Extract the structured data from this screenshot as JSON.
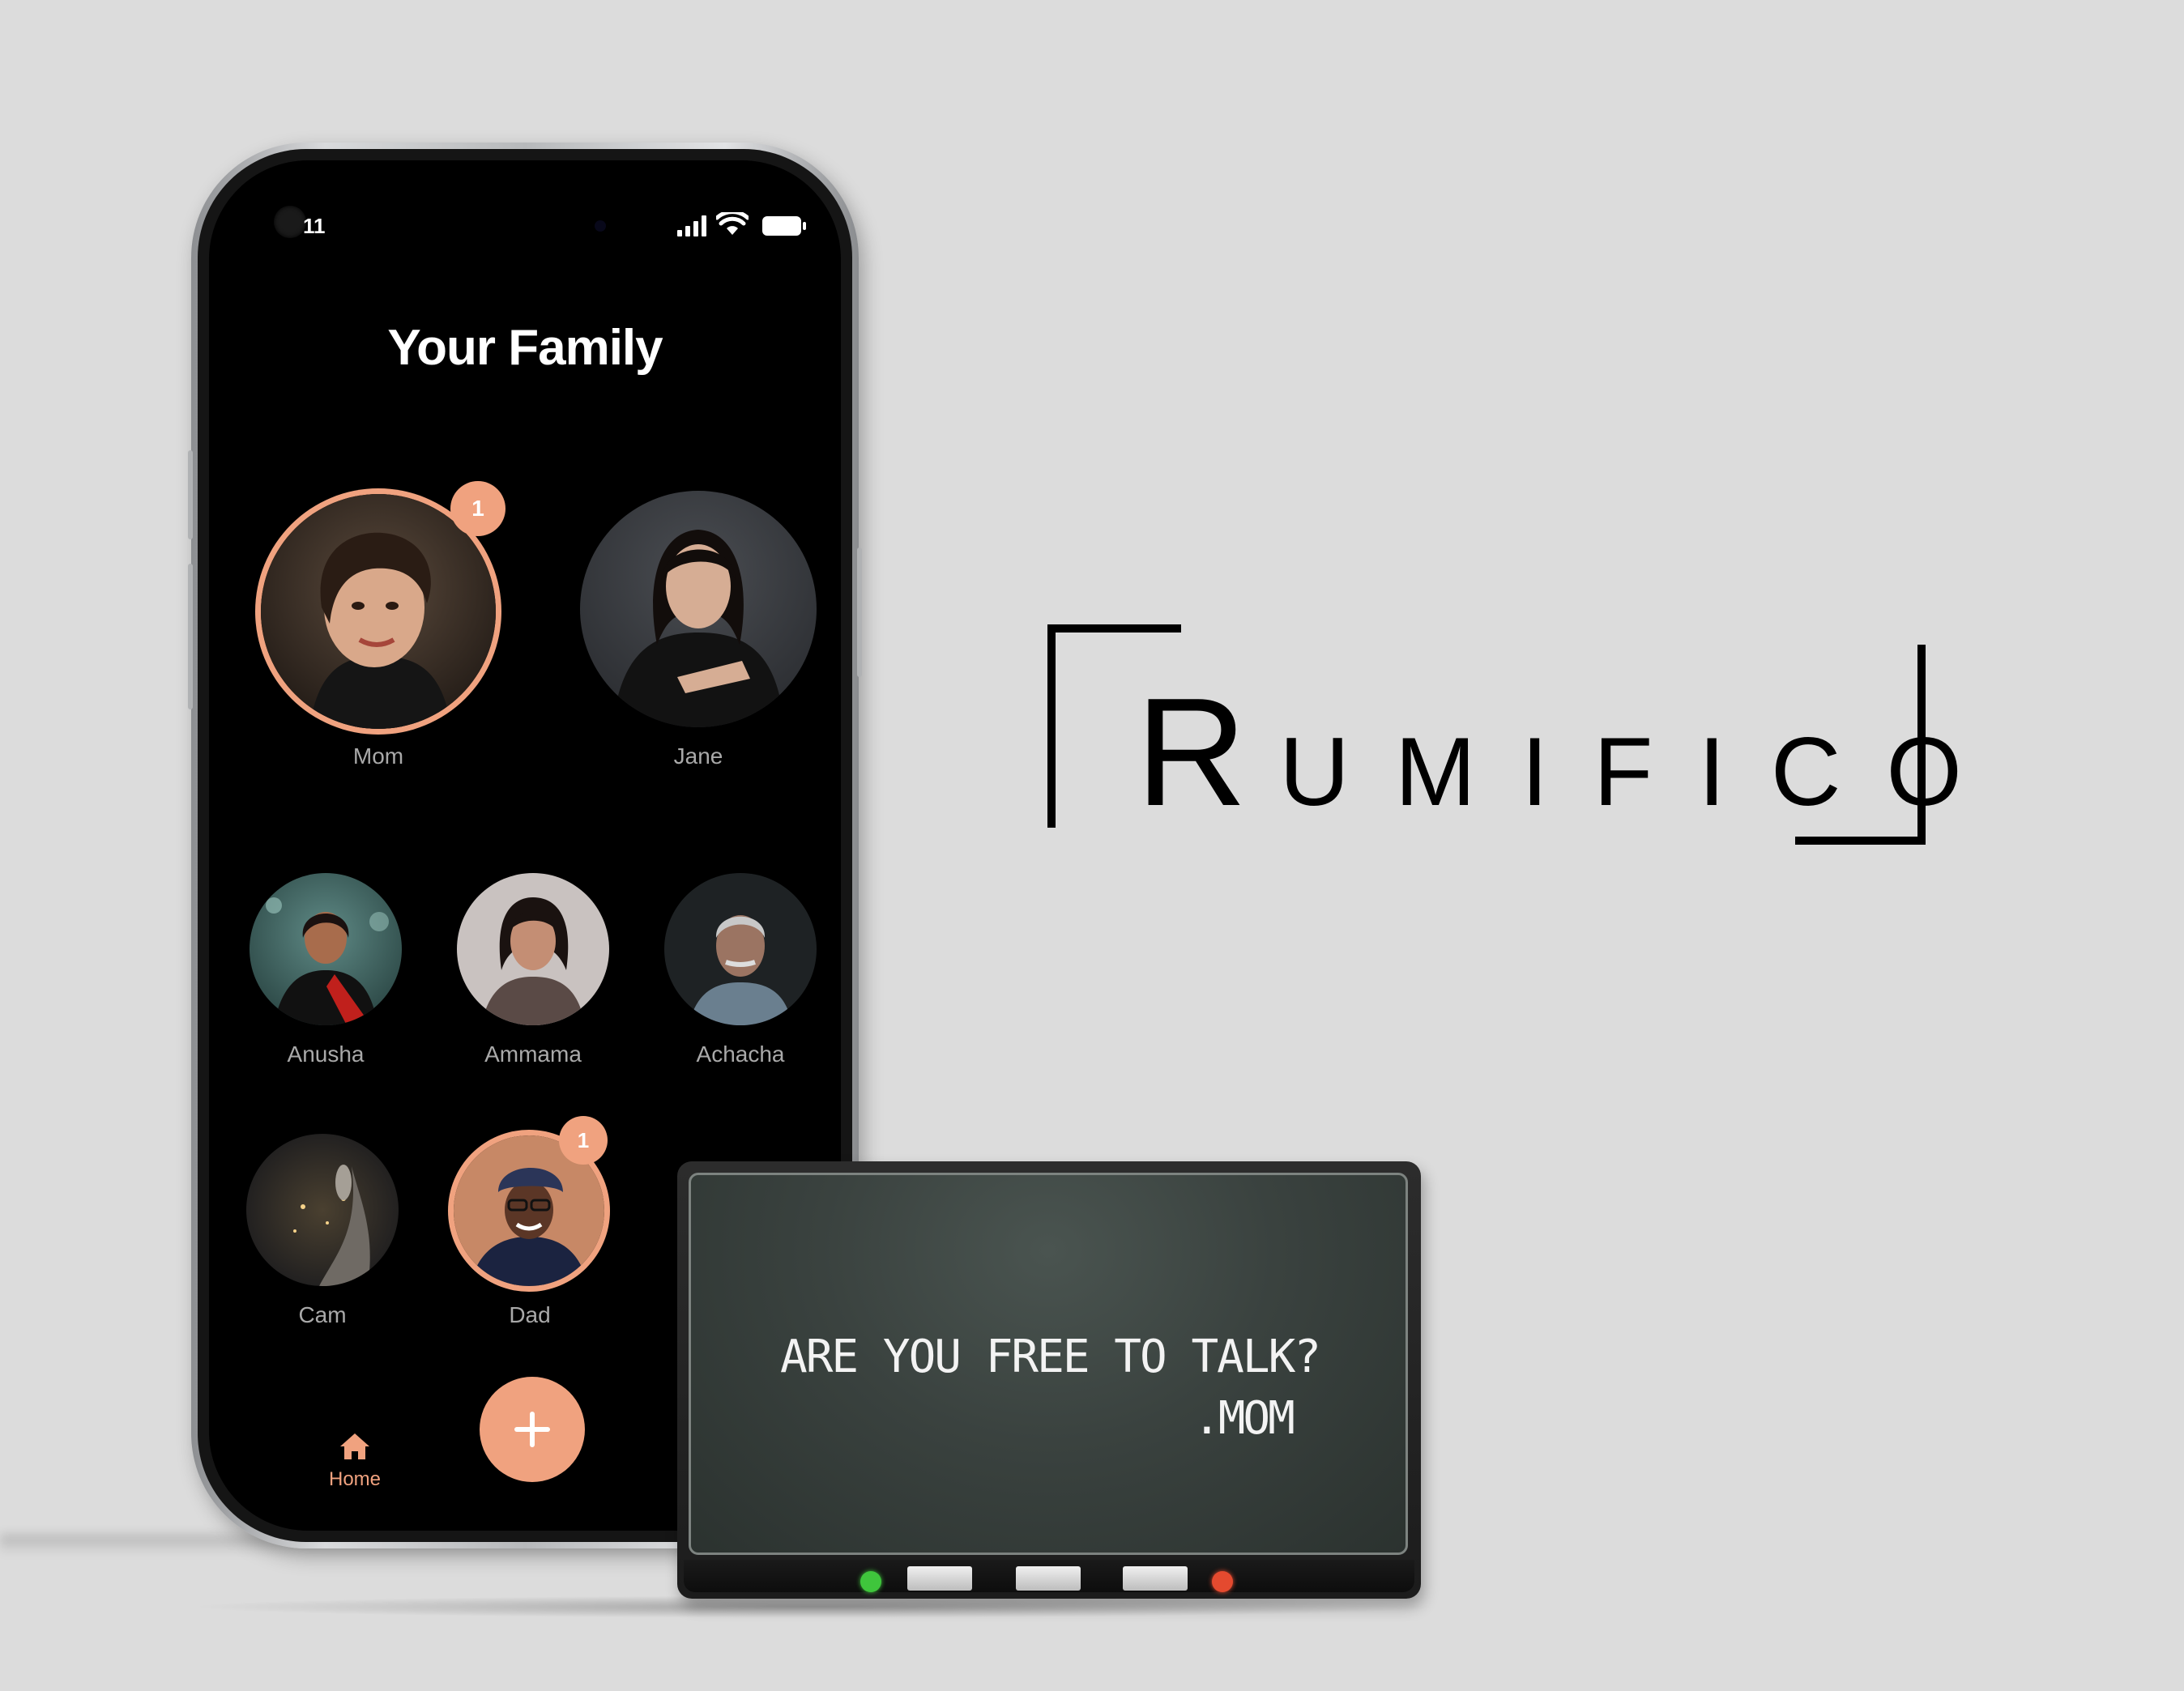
{
  "status_bar": {
    "time": "11",
    "icons": [
      "signal-icon",
      "wifi-icon",
      "battery-icon"
    ]
  },
  "page": {
    "title": "Your Family"
  },
  "family": {
    "members": [
      {
        "name": "Mom",
        "badge": "1",
        "highlighted": true
      },
      {
        "name": "Jane",
        "badge": null,
        "highlighted": false
      },
      {
        "name": "Anusha",
        "badge": null,
        "highlighted": false
      },
      {
        "name": "Ammama",
        "badge": null,
        "highlighted": false
      },
      {
        "name": "Achacha",
        "badge": null,
        "highlighted": false
      },
      {
        "name": "Cam",
        "badge": null,
        "highlighted": false
      },
      {
        "name": "Dad",
        "badge": "1",
        "highlighted": true
      }
    ]
  },
  "nav": {
    "home_label": "Home",
    "home_icon": "home-icon",
    "add_icon": "plus-icon"
  },
  "brand": {
    "first_letter": "R",
    "rest": "UMIFICO"
  },
  "device": {
    "message": "ARE YOU FREE TO TALK?",
    "sender": ".MOM",
    "leds": {
      "left": "#3fc53c",
      "right": "#e44a2f"
    }
  },
  "colors": {
    "accent": "#f0a27f",
    "background": "#dcdcdc",
    "screen": "#000000"
  }
}
